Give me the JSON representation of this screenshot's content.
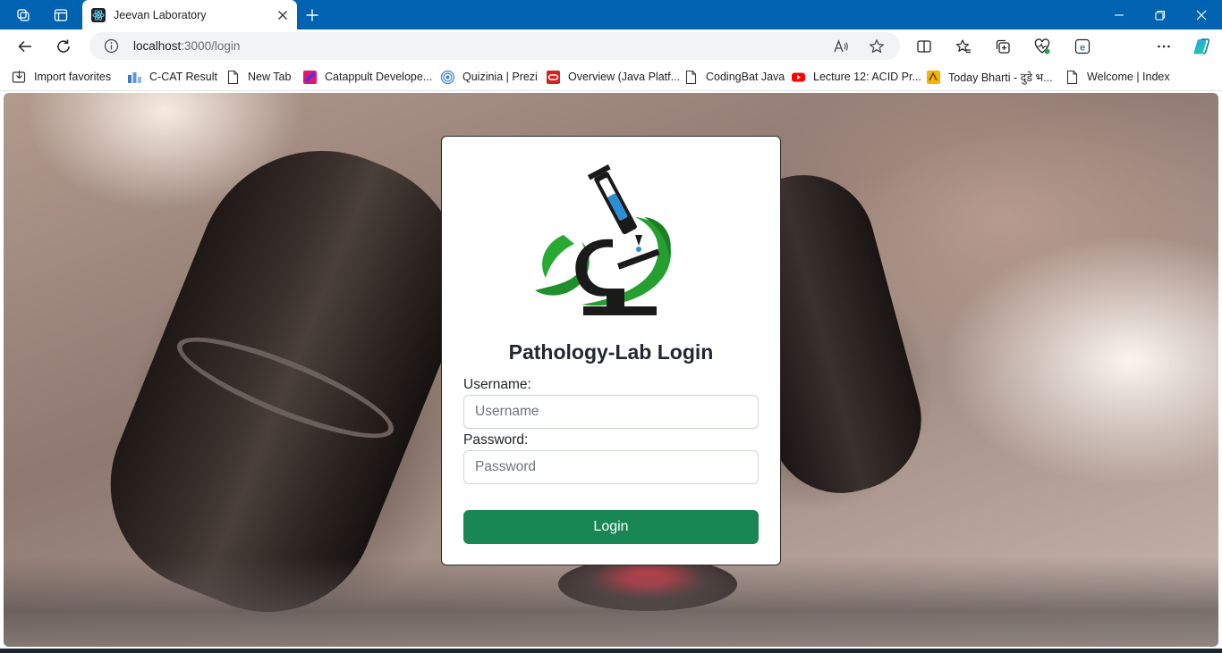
{
  "browser": {
    "tab": {
      "title": "Jeevan Laboratory"
    },
    "address": {
      "host": "localhost",
      "path": ":3000/login"
    },
    "favorites": [
      {
        "label": "Import favorites",
        "icon": "import-icon"
      },
      {
        "label": "C-CAT Result",
        "icon": "site-icon"
      },
      {
        "label": "New Tab",
        "icon": "page-icon"
      },
      {
        "label": "Catappult Develope...",
        "icon": "catappult-icon"
      },
      {
        "label": "Quizinia | Prezi",
        "icon": "quizinia-icon"
      },
      {
        "label": "Overview (Java Platf...",
        "icon": "oracle-icon"
      },
      {
        "label": "CodingBat Java",
        "icon": "page-icon"
      },
      {
        "label": "Lecture 12: ACID Pr...",
        "icon": "youtube-icon"
      },
      {
        "label": "Today Bharti - दुडे भ...",
        "icon": "bharti-icon"
      },
      {
        "label": "Welcome | Index",
        "icon": "page-icon"
      }
    ]
  },
  "login": {
    "title": "Pathology-Lab Login",
    "username_label": "Username:",
    "username_placeholder": "Username",
    "password_label": "Password:",
    "password_placeholder": "Password",
    "submit_label": "Login"
  },
  "colors": {
    "titlebar": "#0063b1",
    "button": "#198754"
  }
}
